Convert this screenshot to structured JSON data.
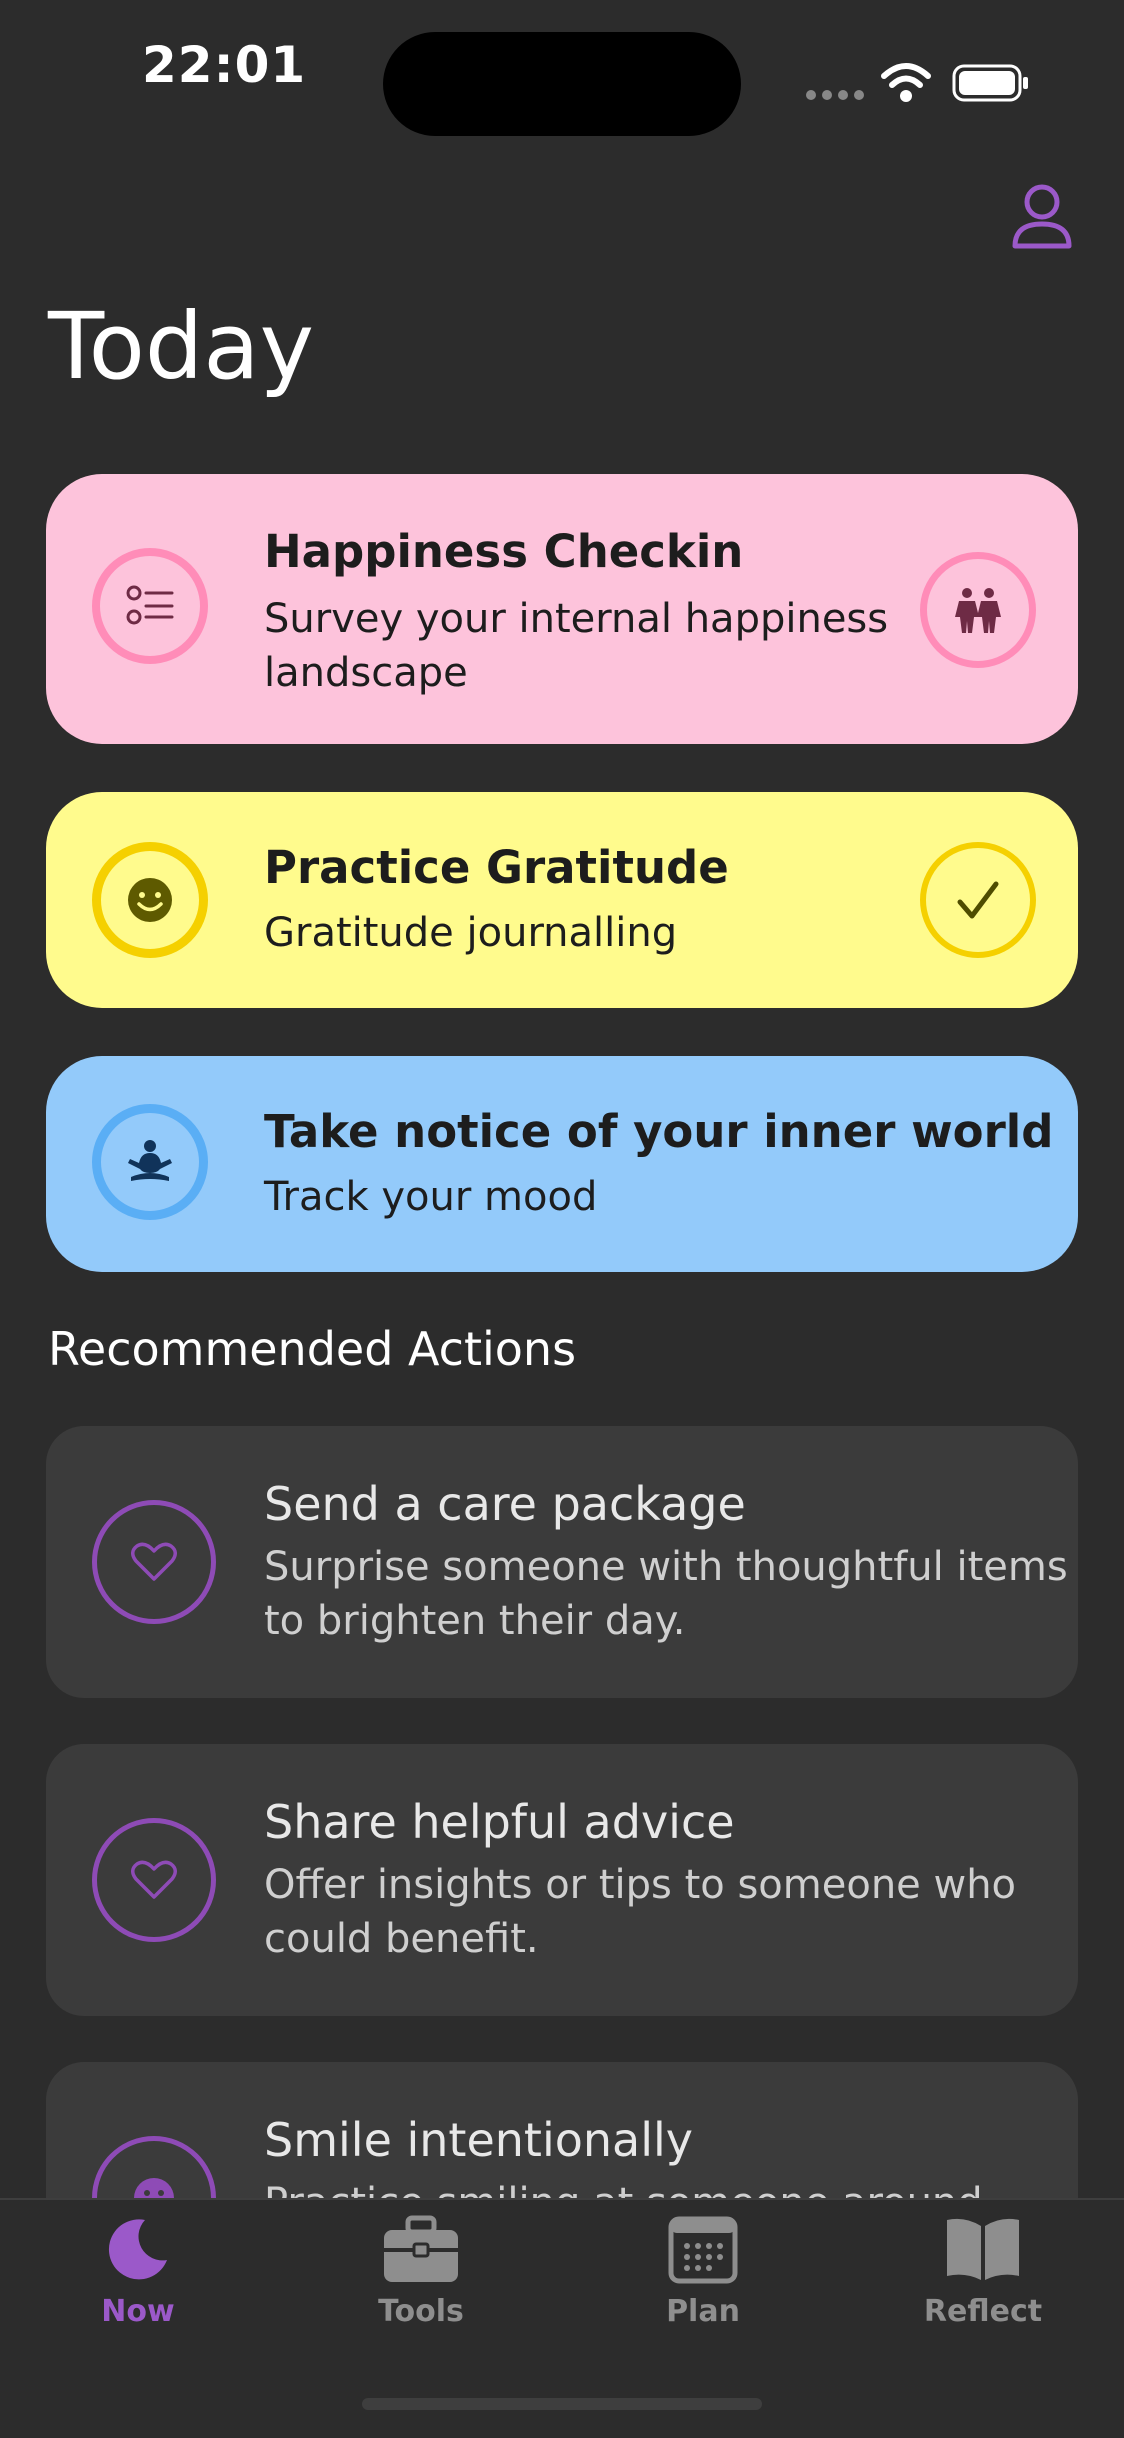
{
  "status_bar": {
    "time": "22:01"
  },
  "header": {
    "title": "Today"
  },
  "cards": [
    {
      "title": "Happiness Checkin",
      "subtitle": "Survey your internal happiness landscape",
      "icon": "checklist-icon",
      "right_icon": "people-icon"
    },
    {
      "title": "Practice Gratitude",
      "subtitle": "Gratitude journalling",
      "icon": "smile-icon",
      "right_icon": "checkmark-icon"
    },
    {
      "title": "Take notice of your inner world",
      "subtitle": "Track your mood",
      "icon": "meditation-icon"
    }
  ],
  "section": {
    "title": "Recommended Actions"
  },
  "recommended": [
    {
      "title": "Send a care package",
      "subtitle": "Surprise someone with thoughtful items to brighten their day.",
      "icon": "heart-icon"
    },
    {
      "title": "Share helpful advice",
      "subtitle": "Offer insights or tips to someone who could benefit.",
      "icon": "heart-icon"
    },
    {
      "title": "Smile intentionally",
      "subtitle": "Practice smiling at someone around",
      "icon": "smile-icon"
    }
  ],
  "tabs": [
    {
      "label": "Now",
      "icon": "moon-icon",
      "active": true
    },
    {
      "label": "Tools",
      "icon": "toolbox-icon"
    },
    {
      "label": "Plan",
      "icon": "calendar-icon"
    },
    {
      "label": "Reflect",
      "icon": "book-icon"
    }
  ],
  "colors": {
    "background": "#2c2c2c",
    "accent": "#9b59c9",
    "pink": "#fdc3db",
    "yellow": "#fffb8d",
    "blue": "#93cafa",
    "card": "#3b3b3b"
  }
}
